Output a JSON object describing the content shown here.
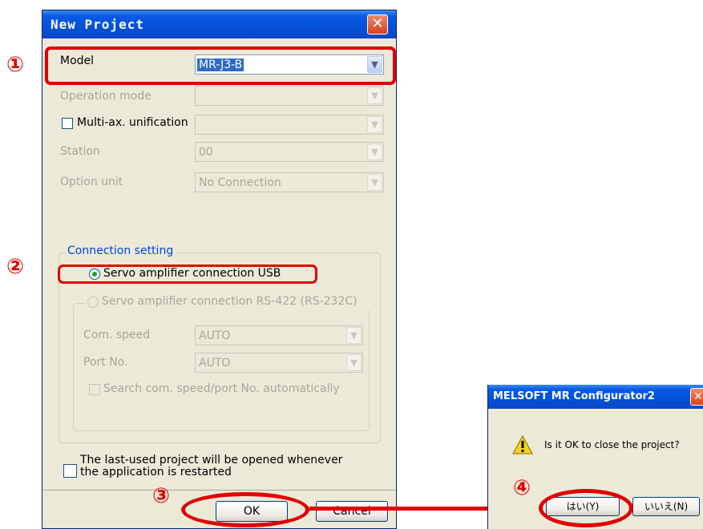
{
  "dialog": {
    "title": "New Project",
    "close_glyph": "✕",
    "model_label": "Model",
    "model_value": "MR-J3-B",
    "operation_mode_label": "Operation mode",
    "multi_axis_label": "Multi-ax. unification",
    "station_label": "Station",
    "station_value": "00",
    "option_unit_label": "Option unit",
    "option_unit_value": "No Connection",
    "connection_group_label": "Connection setting",
    "usb_radio_label": "Servo amplifier connection USB",
    "rs422_radio_label": "Servo amplifier connection RS-422 (RS-232C)",
    "com_speed_label": "Com. speed",
    "com_speed_value": "AUTO",
    "port_label": "Port No.",
    "port_value": "AUTO",
    "search_auto_label": "Search com. speed/port No. automatically",
    "last_used_label": "The last-used project will be opened whenever the application is restarted",
    "ok_label": "OK",
    "cancel_label": "Cancel"
  },
  "confirm": {
    "title": "MELSOFT MR Configurator2",
    "message": "Is it OK to close the project?",
    "yes_label": "はい(Y)",
    "no_label": "いいえ(N)",
    "close_glyph": "✕",
    "icon": "warning-icon"
  },
  "annotations": {
    "step1": "①",
    "step2": "②",
    "step3": "③",
    "step4": "④"
  },
  "colors": {
    "annotation_red": "#e00000",
    "titlebar_blue": "#0551d8",
    "dialog_bg": "#ece9d8",
    "group_label_blue": "#0046d5"
  }
}
